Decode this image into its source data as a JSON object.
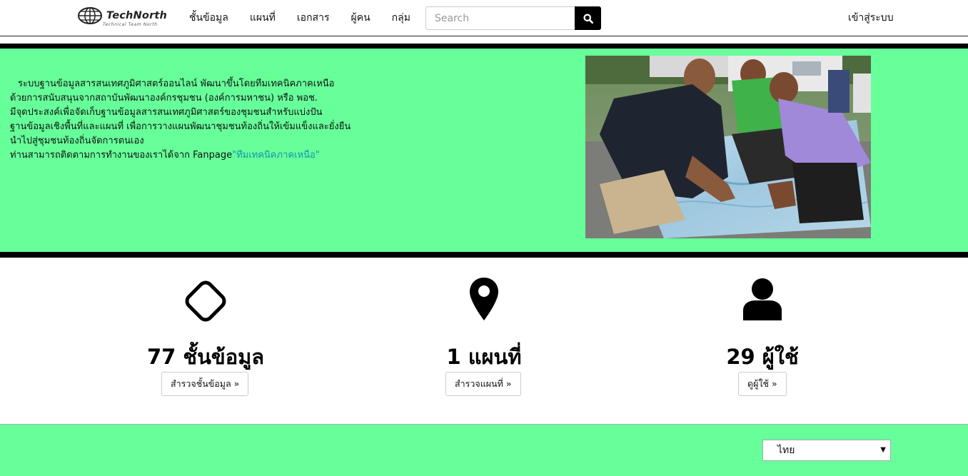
{
  "brand": {
    "name": "TechNorth",
    "tagline": "Technical Team North"
  },
  "nav": {
    "items": [
      {
        "label": "ชั้นข้อมูล"
      },
      {
        "label": "แผนที่"
      },
      {
        "label": "เอกสาร"
      },
      {
        "label": "ผู้คน"
      },
      {
        "label": "กลุ่ม"
      }
    ],
    "login_label": "เข้าสู่ระบบ"
  },
  "search": {
    "placeholder": "Search",
    "icon": "search-icon"
  },
  "hero": {
    "lines": [
      "ระบบฐานข้อมูลสารสนเทศภูมิศาสตร์ออนไลน์ พัฒนาขึ้นโดยทีมเทคนิคภาคเหนือ",
      "ด้วยการสนับสนุนจากสถาบันพัฒนาองค์กรชุมชน (องค์การมหาชน) หรือ พอช.",
      "มีจุดประสงค์เพื่อจัดเก็บฐานข้อมูลสารสนเทศภูมิศาสตร์ของชุมชนสำหรับแบ่งปัน",
      "ฐานข้อมูลเชิงพื้นที่และแผนที่ เพื่อการวางแผนพัฒนาชุมชนท้องถิ่นให้เข้มแข็งและยั่งยืน",
      "นำไปสู่ชุมชนท้องถิ่นจัดการตนเอง"
    ],
    "fanpage_prefix": "ท่านสามารถติดตามการทำงานของเราได้จาก Fanpage",
    "fanpage_link": "\"ทีมเทคนิคภาคเหนือ\""
  },
  "stats": [
    {
      "icon": "diamond-icon",
      "count": "77 ชั้นข้อมูล",
      "button": "สำรวจชั้นข้อมูล »"
    },
    {
      "icon": "map-marker-icon",
      "count": "1 แผนที่",
      "button": "สำรวจแผนที่ »"
    },
    {
      "icon": "user-icon",
      "count": "29 ผู้ใช้",
      "button": "ดูผู้ใช้ »"
    }
  ],
  "footer": {
    "language": "ไทย"
  },
  "colors": {
    "hero_bg": "#66ff99",
    "bar": "#000000",
    "link": "#1a8fb5"
  }
}
